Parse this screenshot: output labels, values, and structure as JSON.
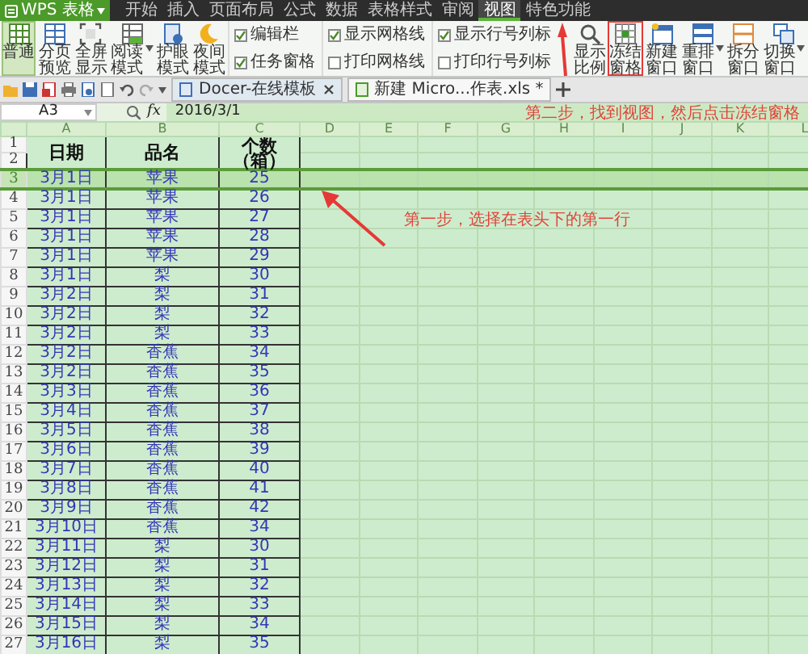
{
  "app_button": "WPS 表格",
  "menu": [
    {
      "label": "开始",
      "selected": false
    },
    {
      "label": "插入",
      "selected": false
    },
    {
      "label": "页面布局",
      "selected": false
    },
    {
      "label": "公式",
      "selected": false
    },
    {
      "label": "数据",
      "selected": false
    },
    {
      "label": "表格样式",
      "selected": false
    },
    {
      "label": "审阅",
      "selected": false
    },
    {
      "label": "视图",
      "selected": true
    },
    {
      "label": "特色功能",
      "selected": false
    }
  ],
  "ribbon": [
    {
      "kind": "button",
      "label": "普通",
      "selected": true
    },
    {
      "kind": "button",
      "label": "分页预览",
      "selected": false
    },
    {
      "kind": "button",
      "label": "全屏显示",
      "selected": false
    },
    {
      "kind": "button",
      "label": "阅读模式",
      "selected": false,
      "dropdown": true
    },
    {
      "kind": "button",
      "label": "护眼模式",
      "selected": false
    },
    {
      "kind": "button",
      "label": "夜间模式",
      "selected": false
    },
    {
      "kind": "checks",
      "items": [
        {
          "label": "编辑栏",
          "checked": true
        },
        {
          "label": "任务窗格",
          "checked": true
        }
      ]
    },
    {
      "kind": "checks",
      "items": [
        {
          "label": "显示网格线",
          "checked": true
        },
        {
          "label": "打印网格线",
          "checked": false
        }
      ]
    },
    {
      "kind": "checks",
      "items": [
        {
          "label": "显示行号列标",
          "checked": true
        },
        {
          "label": "打印行号列标",
          "checked": false
        }
      ]
    },
    {
      "kind": "button",
      "label": "显示比例",
      "selected": false
    },
    {
      "kind": "button",
      "label": "冻结窗格",
      "selected": false,
      "highlighted": true
    },
    {
      "kind": "button",
      "label": "新建窗口",
      "selected": false
    },
    {
      "kind": "button",
      "label": "重排窗口",
      "selected": false,
      "dropdown": true
    },
    {
      "kind": "button",
      "label": "拆分窗口",
      "selected": false
    },
    {
      "kind": "button",
      "label": "切换窗口",
      "selected": false,
      "dropdown": true
    }
  ],
  "tabs": [
    {
      "label": "Docer-在线模板",
      "selected": false,
      "closable": true
    },
    {
      "label": "新建 Micro...作表.xls *",
      "selected": true,
      "closable": false
    }
  ],
  "formula_bar": {
    "cell_ref": "A3",
    "function_label": "fx",
    "value": "2016/3/1"
  },
  "sheet": {
    "columns": [
      "A",
      "B",
      "C",
      "D",
      "E",
      "F",
      "G",
      "H",
      "I",
      "J",
      "K",
      "L"
    ],
    "header_row_numbers": [
      "1",
      "2"
    ],
    "header": [
      "日期",
      "品名",
      "个数（箱）"
    ],
    "rows": [
      {
        "number": "3",
        "selected": true,
        "cells": [
          "3月1日",
          "苹果",
          "25"
        ]
      },
      {
        "number": "4",
        "selected": false,
        "cells": [
          "3月1日",
          "苹果",
          "26"
        ]
      },
      {
        "number": "5",
        "selected": false,
        "cells": [
          "3月1日",
          "苹果",
          "27"
        ]
      },
      {
        "number": "6",
        "selected": false,
        "cells": [
          "3月1日",
          "苹果",
          "28"
        ]
      },
      {
        "number": "7",
        "selected": false,
        "cells": [
          "3月1日",
          "苹果",
          "29"
        ]
      },
      {
        "number": "8",
        "selected": false,
        "cells": [
          "3月1日",
          "梨",
          "30"
        ]
      },
      {
        "number": "9",
        "selected": false,
        "cells": [
          "3月2日",
          "梨",
          "31"
        ]
      },
      {
        "number": "10",
        "selected": false,
        "cells": [
          "3月2日",
          "梨",
          "32"
        ]
      },
      {
        "number": "11",
        "selected": false,
        "cells": [
          "3月2日",
          "梨",
          "33"
        ]
      },
      {
        "number": "12",
        "selected": false,
        "cells": [
          "3月2日",
          "香蕉",
          "34"
        ]
      },
      {
        "number": "13",
        "selected": false,
        "cells": [
          "3月2日",
          "香蕉",
          "35"
        ]
      },
      {
        "number": "14",
        "selected": false,
        "cells": [
          "3月3日",
          "香蕉",
          "36"
        ]
      },
      {
        "number": "15",
        "selected": false,
        "cells": [
          "3月4日",
          "香蕉",
          "37"
        ]
      },
      {
        "number": "16",
        "selected": false,
        "cells": [
          "3月5日",
          "香蕉",
          "38"
        ]
      },
      {
        "number": "17",
        "selected": false,
        "cells": [
          "3月6日",
          "香蕉",
          "39"
        ]
      },
      {
        "number": "18",
        "selected": false,
        "cells": [
          "3月7日",
          "香蕉",
          "40"
        ]
      },
      {
        "number": "19",
        "selected": false,
        "cells": [
          "3月8日",
          "香蕉",
          "41"
        ]
      },
      {
        "number": "20",
        "selected": false,
        "cells": [
          "3月9日",
          "香蕉",
          "42"
        ]
      },
      {
        "number": "21",
        "selected": false,
        "cells": [
          "3月10日",
          "香蕉",
          "34"
        ]
      },
      {
        "number": "22",
        "selected": false,
        "cells": [
          "3月11日",
          "梨",
          "30"
        ]
      },
      {
        "number": "23",
        "selected": false,
        "cells": [
          "3月12日",
          "梨",
          "31"
        ]
      },
      {
        "number": "24",
        "selected": false,
        "cells": [
          "3月13日",
          "梨",
          "32"
        ]
      },
      {
        "number": "25",
        "selected": false,
        "cells": [
          "3月14日",
          "梨",
          "33"
        ]
      },
      {
        "number": "26",
        "selected": false,
        "cells": [
          "3月15日",
          "梨",
          "34"
        ]
      },
      {
        "number": "27",
        "selected": false,
        "cells": [
          "3月16日",
          "梨",
          "35"
        ]
      }
    ]
  },
  "annotations": [
    "第二步，找到视图，然后点击冻结窗格",
    "第一步，选择在表头下的第一行"
  ]
}
